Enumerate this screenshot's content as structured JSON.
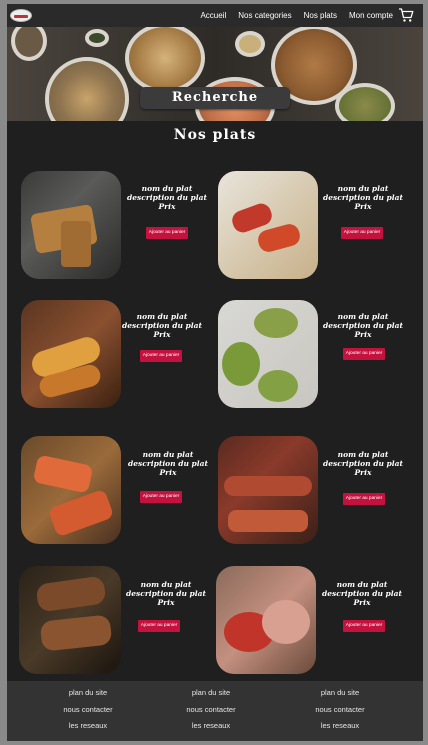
{
  "nav": {
    "links": [
      "Accueil",
      "Nos categories",
      "Nos plats",
      "Mon compte"
    ]
  },
  "hero": {
    "search_label": "Recherche"
  },
  "section": {
    "title": "Nos plats"
  },
  "cards": [
    {
      "name": "nom du plat",
      "description": "description du plat",
      "price": "Prix",
      "button": "Ajouter au panier",
      "image": "spring-rolls"
    },
    {
      "name": "nom du plat",
      "description": "description du plat",
      "price": "Prix",
      "button": "Ajouter au panier",
      "image": "bruschetta"
    },
    {
      "name": "nom du plat",
      "description": "description du plat",
      "price": "Prix",
      "button": "Ajouter au panier",
      "image": "tacos"
    },
    {
      "name": "nom du plat",
      "description": "description du plat",
      "price": "Prix",
      "button": "Ajouter au panier",
      "image": "stuffed-avocado"
    },
    {
      "name": "nom du plat",
      "description": "description du plat",
      "price": "Prix",
      "button": "Ajouter au panier",
      "image": "toasts"
    },
    {
      "name": "nom du plat",
      "description": "description du plat",
      "price": "Prix",
      "button": "Ajouter au panier",
      "image": "buffet"
    },
    {
      "name": "nom du plat",
      "description": "description du plat",
      "price": "Prix",
      "button": "Ajouter au panier",
      "image": "grilled-bread"
    },
    {
      "name": "nom du plat",
      "description": "description du plat",
      "price": "Prix",
      "button": "Ajouter au panier",
      "image": "antipasti"
    }
  ],
  "footer": {
    "columns": [
      {
        "plan": "plan du site",
        "contact": "nous contacter",
        "social": "les reseaux"
      },
      {
        "plan": "plan du site",
        "contact": "nous contacter",
        "social": "les reseaux"
      },
      {
        "plan": "plan du site",
        "contact": "nous contacter",
        "social": "les reseaux"
      }
    ]
  },
  "colors": {
    "background": "#1f1f1f",
    "button": "#c4123f",
    "footer": "#333333"
  }
}
